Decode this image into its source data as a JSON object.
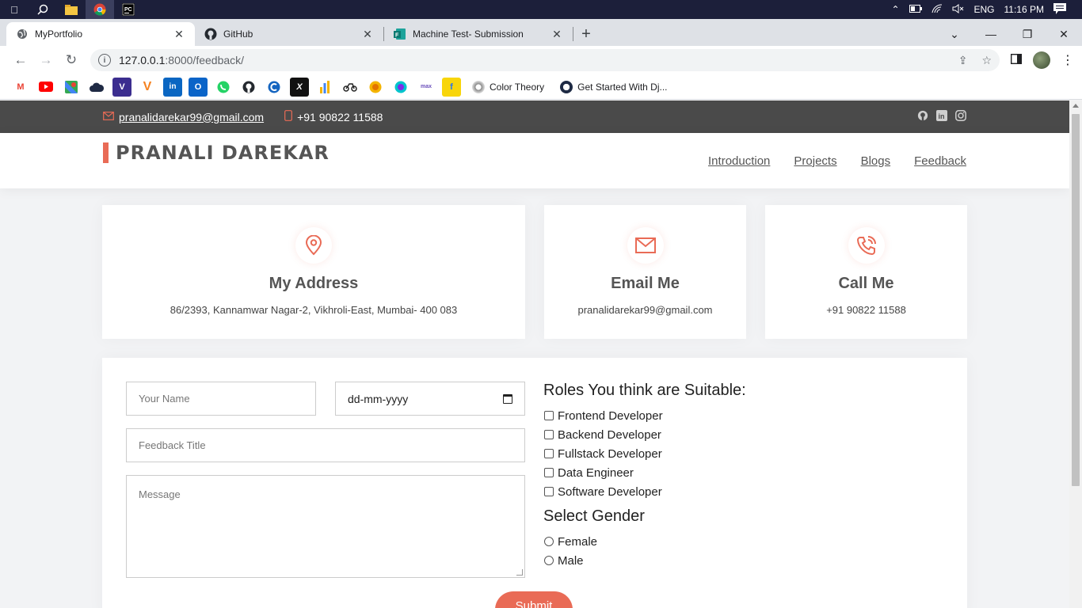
{
  "taskbar": {
    "lang": "ENG",
    "time": "11:16 PM"
  },
  "tabs": [
    {
      "title": "MyPortfolio",
      "icon": "globe-icon"
    },
    {
      "title": "GitHub",
      "icon": "github-icon"
    },
    {
      "title": "Machine Test- Submission",
      "icon": "forms-icon"
    }
  ],
  "address": {
    "host": "127.0.0.1",
    "path": ":8000/feedback/"
  },
  "bookmarks": {
    "color_theory": "Color Theory",
    "django": "Get Started With Dj..."
  },
  "topbar": {
    "email": "pranalidarekar99@gmail.com",
    "phone": "+91 90822 11588"
  },
  "header": {
    "logo": "PRANALI DAREKAR",
    "nav": [
      "Introduction",
      "Projects",
      "Blogs",
      "Feedback"
    ]
  },
  "cards": [
    {
      "title": "My Address",
      "text": "86/2393, Kannamwar Nagar-2, Vikhroli-East, Mumbai- 400 083"
    },
    {
      "title": "Email Me",
      "text": "pranalidarekar99@gmail.com"
    },
    {
      "title": "Call Me",
      "text": "+91 90822 11588"
    }
  ],
  "form": {
    "name_placeholder": "Your Name",
    "date_placeholder": "dd-mm-yyyy",
    "title_placeholder": "Feedback Title",
    "message_placeholder": "Message",
    "roles_heading": "Roles You think are Suitable:",
    "roles": [
      "Frontend Developer",
      "Backend Developer",
      "Fullstack Developer",
      "Data Engineer",
      "Software Developer"
    ],
    "gender_heading": "Select Gender",
    "genders": [
      "Female",
      "Male"
    ],
    "submit_label": "Submit"
  },
  "colors": {
    "accent": "#e96b56",
    "topbar": "#4a4a4a"
  }
}
